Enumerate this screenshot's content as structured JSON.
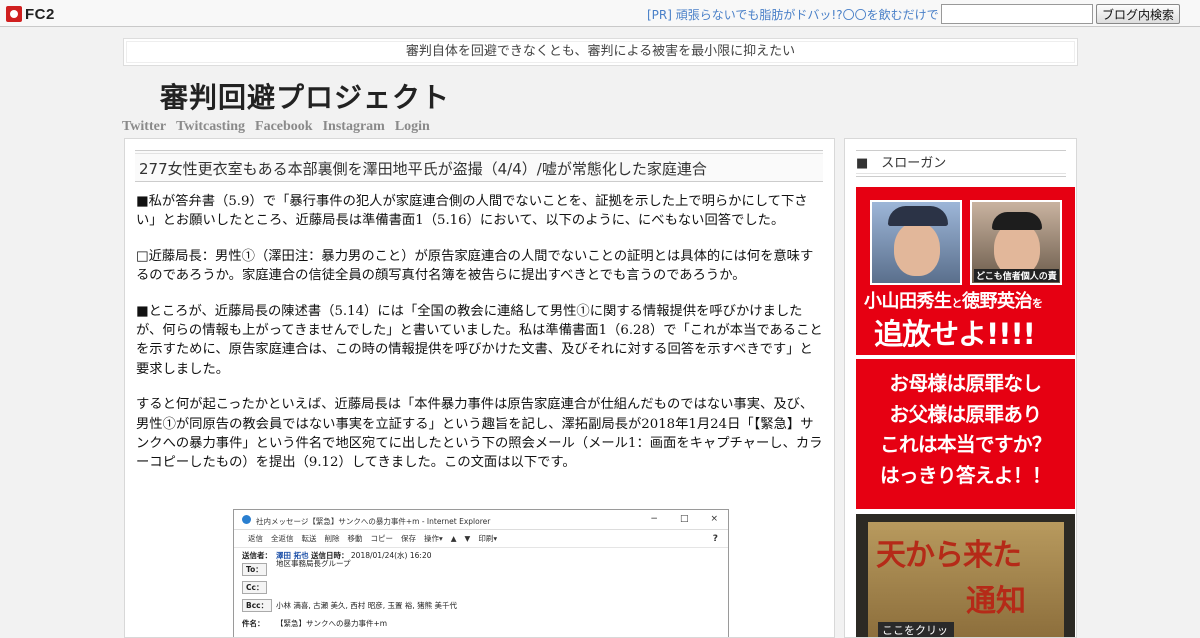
{
  "fc2bar": {
    "logo_text": "FC2",
    "pr_link": "[PR] 頑張らないでも脂肪がドバッ!?〇〇を飲むだけで",
    "search_value": "",
    "search_button": "ブログ内検索"
  },
  "tagline": "審判自体を回避できなくとも、審判による被害を最小限に抑えたい",
  "blog_title": "審判回避プロジェクト",
  "nav": [
    "Twitter",
    "Twitcasting",
    "Facebook",
    "Instagram",
    "Login"
  ],
  "entry": {
    "title": "277女性更衣室もある本部裏側を澤田地平氏が盗撮（4/4）/嘘が常態化した家庭連合",
    "paragraphs": [
      "■私が答弁書（5.9）で「暴行事件の犯人が家庭連合側の人間でないことを、証拠を示した上で明らかにして下さい」とお願いしたところ、近藤局長は準備書面1（5.16）において、以下のように、にべもない回答でした。",
      "□近藤局長：男性①（澤田注：暴力男のこと）が原告家庭連合の人間でないことの証明とは具体的には何を意味するのであろうか。家庭連合の信徒全員の顔写真付名簿を被告らに提出すべきとでも言うのであろうか。",
      "■ところが、近藤局長の陳述書（5.14）には「全国の教会に連絡して男性①に関する情報提供を呼びかけましたが、何らの情報も上がってきませんでした」と書いていました。私は準備書面1（6.28）で「これが本当であることを示すために、原告家庭連合は、この時の情報提供を呼びかけた文書、及びそれに対する回答を示すべきです」と要求しました。",
      "すると何が起こったかといえば、近藤局長は「本件暴力事件は原告家庭連合が仕組んだものではない事実、及び、男性①が同原告の教会員ではない事実を立証する」という趣旨を記し、澤拓副局長が2018年1月24日「【緊急】サンクへの暴力事件」という件名で地区宛てに出したという下の照会メール（メール1：画面をキャプチャーし、カラーコピーしたもの）を提出（9.12）してきました。この文面は以下です。"
    ]
  },
  "screenshot": {
    "window_title": "社内メッセージ【緊急】サンクへの暴力事件+m - Internet Explorer",
    "controls": [
      "−",
      "□",
      "×"
    ],
    "toolbar": [
      "返信",
      "全返信",
      "転送",
      "削除",
      "移動",
      "コピー",
      "保存",
      "操作▾",
      "▲",
      "▼",
      "印刷▾"
    ],
    "help": "?",
    "sender_label": "送信者：",
    "sender_name": "澤田 拓也",
    "sent_label": "送信日時：",
    "sent_value": "2018/01/24(水) 16:20",
    "to_label": "To：",
    "to_value": "地区事務局長グループ",
    "cc_label": "Cc：",
    "bcc_label": "Bcc：",
    "bcc_value": "小林 満喜, 古瀬 美久, 西村 昭彦, 玉置 裕, 猪熊 美千代",
    "subject_label": "件名：",
    "subject_value": "【緊急】サンクへの暴力事件+m"
  },
  "sidebar": {
    "heading": "■　スローガン",
    "banner1": {
      "caption": "どこも信者個人の責",
      "line1_a": "小山田秀生",
      "line1_b": "と",
      "line1_c": "徳野英治",
      "line1_d": "を",
      "line2": "追放せよ!!!!"
    },
    "banner2": [
      "お母様は原罪なし",
      "お父様は原罪あり",
      "これは本当ですか？",
      "はっきり答えよ！！"
    ],
    "banner3": {
      "line1": "天から来た",
      "line2": "通知",
      "line3": "ここをクリック"
    }
  },
  "colors": {
    "link_blue": "#4a80c8",
    "banner_red": "#e60012",
    "nav_gray": "#8a8a8a"
  }
}
